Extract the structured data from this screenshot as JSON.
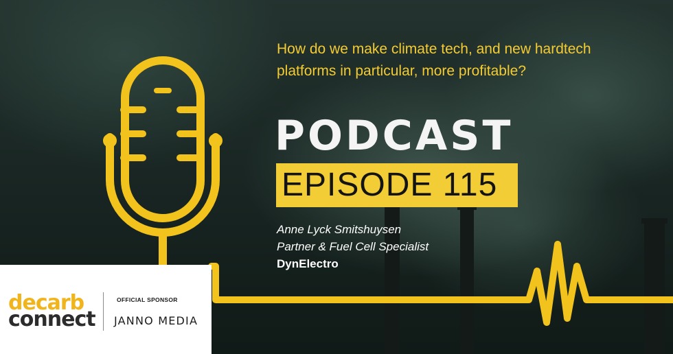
{
  "question": "How do we make climate tech, and new hardtech platforms in particular, more profitable?",
  "title": "PODCAST",
  "episode": "EPISODE 115",
  "guest": {
    "name": "Anne Lyck Smitshuysen",
    "role": "Partner & Fuel Cell Specialist",
    "company": "DynElectro"
  },
  "sponsor": {
    "logo_top": "decarb",
    "logo_bottom": "connect",
    "label": "OFFICIAL SPONSOR",
    "name": "JANNO MEDIA"
  },
  "colors": {
    "accent": "#f4cc32",
    "badge": "#f2cd35",
    "background": "#1a2724",
    "text": "#ffffff"
  },
  "icons": [
    "microphone-icon",
    "heartbeat-line-icon"
  ]
}
